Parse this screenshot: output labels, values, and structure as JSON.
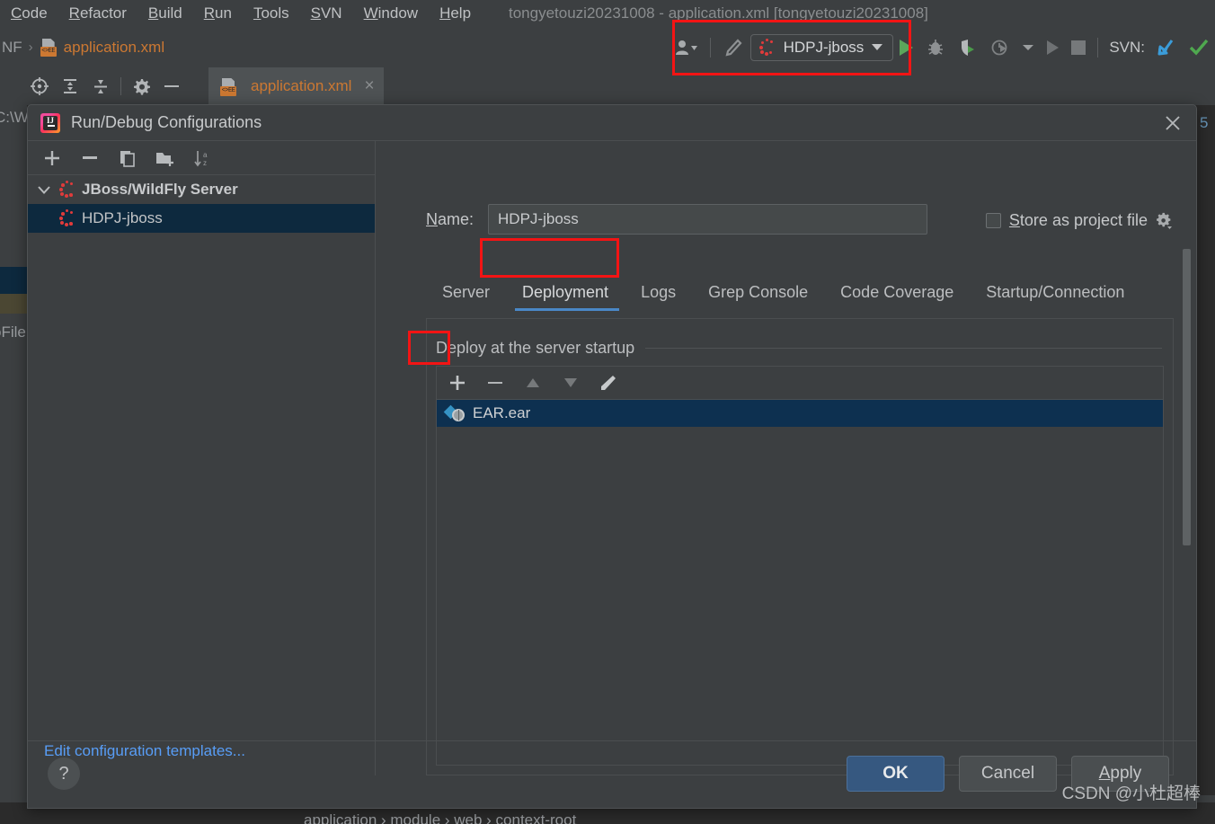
{
  "window": {
    "title": "tongyetouzi20231008 - application.xml [tongyetouzi20231008]"
  },
  "menubar": {
    "items": [
      {
        "label": "Code",
        "mnemonic": "C"
      },
      {
        "label": "Refactor",
        "mnemonic": "R"
      },
      {
        "label": "Build",
        "mnemonic": "B"
      },
      {
        "label": "Run",
        "mnemonic": "R"
      },
      {
        "label": "Tools",
        "mnemonic": "T"
      },
      {
        "label": "SVN",
        "mnemonic": "S"
      },
      {
        "label": "Window",
        "mnemonic": "W"
      },
      {
        "label": "Help",
        "mnemonic": "H"
      }
    ]
  },
  "breadcrumb": {
    "prefix": "NF",
    "separator": "›",
    "file": "application.xml"
  },
  "toolbar": {
    "run_config_name": "HDPJ-jboss",
    "svn_label": "SVN:",
    "icons": [
      "user-dropdown-icon",
      "build-hammer-icon",
      "run-icon",
      "debug-icon",
      "coverage-icon",
      "profiler-icon",
      "profiler-dropdown-icon",
      "rerun-icon",
      "stop-icon",
      "svn-update-icon",
      "svn-commit-icon"
    ]
  },
  "editor": {
    "tools": [
      "target-icon",
      "expand-all-icon",
      "collapse-all-icon",
      "settings-icon",
      "minimize-icon"
    ],
    "tab_label": "application.xml",
    "tab_close": "×"
  },
  "background": {
    "path_text": "C:\\W",
    "file_text": "oFile",
    "line_number": "5",
    "bottom_breadcrumb": "application  ›  module  ›  web  ›  context-root"
  },
  "dialog": {
    "title": "Run/Debug Configurations",
    "close_label": "×",
    "left_panel": {
      "toolbar": [
        "add-icon",
        "remove-icon",
        "copy-icon",
        "new-folder-icon",
        "sort-icon"
      ],
      "tree": [
        {
          "label": "JBoss/WildFly Server",
          "type": "group",
          "expanded": true
        },
        {
          "label": "HDPJ-jboss",
          "type": "config",
          "selected": true
        }
      ],
      "footer_link": "Edit configuration templates..."
    },
    "right_panel": {
      "name_label": "Name:",
      "name_mnemonic": "N",
      "name_value": "HDPJ-jboss",
      "store_as_project_file_label": "Store as project file",
      "store_mnemonic": "S",
      "store_checked": false,
      "gear_icon": "gear-dropdown-icon",
      "tabs": [
        {
          "label": "Server",
          "active": false
        },
        {
          "label": "Deployment",
          "active": true
        },
        {
          "label": "Logs",
          "active": false
        },
        {
          "label": "Grep Console",
          "active": false
        },
        {
          "label": "Code Coverage",
          "active": false
        },
        {
          "label": "Startup/Connection",
          "active": false
        }
      ],
      "deployment": {
        "group_title": "Deploy at the server startup",
        "toolbar": [
          "add-icon",
          "remove-icon",
          "move-up-icon",
          "move-down-icon",
          "edit-pencil-icon"
        ],
        "items": [
          {
            "label": "EAR.ear",
            "icon": "ear-artifact-icon",
            "selected": true
          }
        ]
      }
    },
    "footer": {
      "help_label": "?",
      "ok_label": "OK",
      "cancel_label": "Cancel",
      "apply_label": "Apply",
      "apply_mnemonic": "A"
    }
  },
  "watermark": "CSDN @小杜超棒",
  "colors": {
    "accent_blue": "#4a88c7",
    "selection_blue": "#0d3050",
    "annotation_red": "#f31414",
    "link_blue": "#589df6",
    "file_orange": "#cc7832",
    "run_green": "#5ba65b",
    "primary_button": "#365880"
  }
}
